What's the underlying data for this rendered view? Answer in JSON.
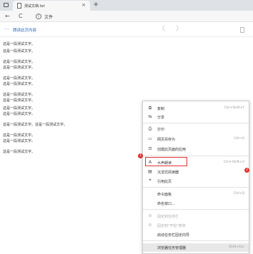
{
  "browser": {
    "tab_title": "测试文档.txt",
    "tab_close": "×",
    "new_tab": "+",
    "back": "←",
    "refresh": "C",
    "info": "i",
    "address_text": "文件"
  },
  "reader": {
    "dots": "···",
    "label": "朗读此页内容",
    "prev": "〈",
    "next": "〉"
  },
  "content": {
    "lines": [
      "这是一段测试文字。",
      "这是一段测试文字。",
      "这是一段测试文字。",
      "这是一段测试文字。",
      "这是一段测试文字。",
      "这是一段测试文字。",
      "这是一段测试文字。",
      "这是一段测试文字。",
      "这是一段测试文字。",
      "这是一段测试文字。",
      "这是一段测试文字。这是一段测试文字。",
      "这是一段测试文字。",
      "这是一段测试文字。",
      "这是一段测试文字。"
    ]
  },
  "menu": {
    "items": [
      {
        "icon": "⧉",
        "label": "复制",
        "shortcut": "Ctrl+Shift+Y",
        "icon_name": "copy-icon"
      },
      {
        "icon": "⇆",
        "label": "分享",
        "shortcut": "",
        "icon_name": "share-icon"
      },
      {
        "icon": "⎙",
        "label": "打印",
        "shortcut": "",
        "icon_name": "print-icon"
      },
      {
        "icon": "▭",
        "label": "网页另存为",
        "shortcut": "Ctrl+S",
        "icon_name": "save-icon"
      },
      {
        "icon": "⊡",
        "label": "创建此页面的应用",
        "shortcut": "",
        "icon_name": "app-icon"
      },
      {
        "icon": "A",
        "label": "大声朗读",
        "shortcut": "Ctrl+Shift+U",
        "icon_name": "read-aloud-icon"
      },
      {
        "icon": "▤",
        "label": "沉浸式阅读器",
        "shortcut": "",
        "icon_name": "immersive-reader-icon"
      },
      {
        "icon": "❝",
        "label": "引用此页",
        "shortcut": "",
        "icon_name": "quote-icon"
      },
      {
        "icon": "",
        "label": "命令面板",
        "shortcut": "Ctrl+Q",
        "icon_name": "command-icon"
      },
      {
        "icon": "",
        "label": "命名窗口…",
        "shortcut": "",
        "icon_name": "name-window-icon"
      },
      {
        "icon": "⊘",
        "label": "固定到任务栏",
        "shortcut": "",
        "icon_name": "pin-taskbar-icon"
      },
      {
        "icon": "⊘",
        "label": "固定到\"开始\"菜单",
        "shortcut": "",
        "icon_name": "pin-start-icon"
      },
      {
        "icon": "",
        "label": "启动任务栏固定向导",
        "shortcut": "",
        "icon_name": "wizard-icon"
      },
      {
        "icon": "",
        "label": "浏览器任务管理器",
        "shortcut": "Shift+Esc",
        "icon_name": "task-manager-icon"
      }
    ]
  },
  "annotations": {
    "step_1": "1",
    "step_2": "2"
  },
  "colors": {
    "accent": "#2b66c1",
    "annotation_red": "#e03131"
  }
}
